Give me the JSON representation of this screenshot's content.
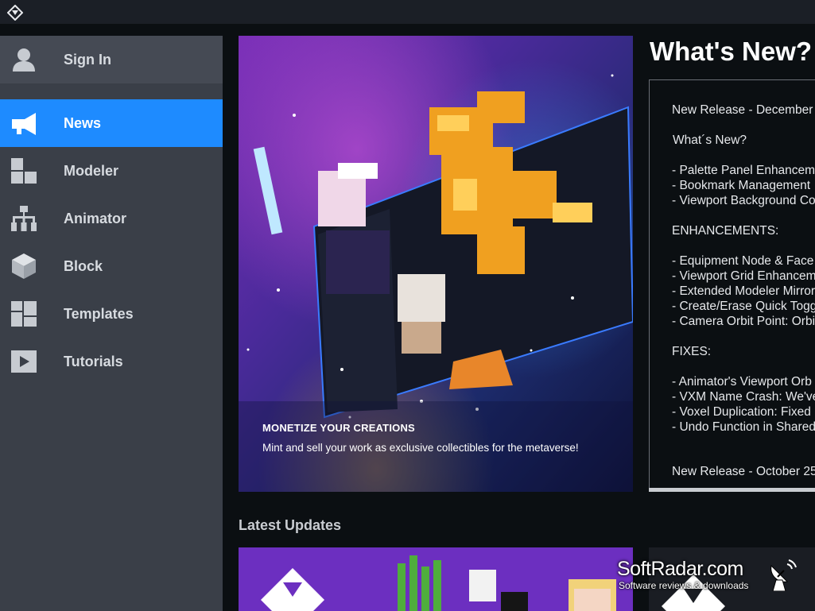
{
  "sidebar": {
    "sign_in": "Sign In",
    "items": [
      {
        "label": "News",
        "icon": "megaphone-icon",
        "active": true
      },
      {
        "label": "Modeler",
        "icon": "blocks-icon",
        "active": false
      },
      {
        "label": "Animator",
        "icon": "hierarchy-icon",
        "active": false
      },
      {
        "label": "Block",
        "icon": "cube-icon",
        "active": false
      },
      {
        "label": "Templates",
        "icon": "layout-icon",
        "active": false
      },
      {
        "label": "Tutorials",
        "icon": "play-icon",
        "active": false
      }
    ]
  },
  "hero": {
    "title": "MONETIZE YOUR CREATIONS",
    "subtitle": "Mint and sell your work as exclusive collectibles for the metaverse!"
  },
  "whats_new": {
    "title": "What's New?",
    "lines": [
      "New Release - December 1",
      "",
      "What´s New?",
      "",
      "- Palette Panel Enhancem",
      "- Bookmark Management",
      "- Viewport Background Co",
      "",
      "ENHANCEMENTS:",
      "",
      "- Equipment Node & Face",
      "- Viewport Grid Enhancem",
      "- Extended Modeler Mirror",
      "- Create/Erase Quick Togg",
      "- Camera Orbit Point: Orbi",
      "",
      "FIXES:",
      "",
      "- Animator's Viewport Orb",
      "- VXM Name Crash: We've",
      "- Voxel Duplication: Fixed",
      "- Undo Function in Shared"
    ],
    "release2": "New Release - October 25"
  },
  "latest_updates": {
    "title": "Latest Updates"
  },
  "watermark": {
    "name": "SoftRadar.com",
    "tagline": "Software reviews & downloads"
  },
  "colors": {
    "accent": "#1e8bff",
    "sidebar": "#3a3f48",
    "background": "#0b0f12"
  }
}
